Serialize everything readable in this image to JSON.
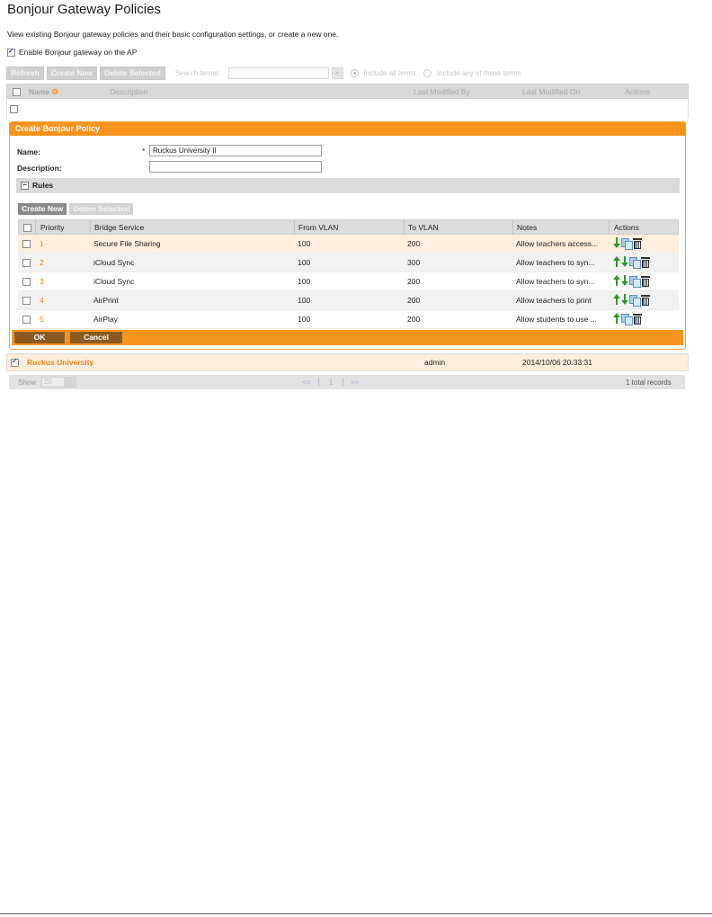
{
  "page": {
    "title": "Bonjour Gateway Policies",
    "intro": "View existing Bonjour gateway policies and their basic configuration settings, or create a new one.",
    "enable_label": "Enable Bonjour gateway on the AP"
  },
  "toolbar": {
    "refresh": "Refresh",
    "create_new": "Create New",
    "delete_selected": "Delete Selected",
    "search_label": "Search terms:",
    "search_value": "",
    "clear": "×",
    "include_all": "Include all terms",
    "include_any": "Include any of these terms"
  },
  "grid": {
    "columns": {
      "name": "Name",
      "description": "Description",
      "last_modified_by": "Last Modified By",
      "last_modified_on": "Last Modified On",
      "actions": "Actions"
    }
  },
  "create_panel": {
    "title": "Create Bonjour Policy",
    "name_label": "Name:",
    "required_mark": "*",
    "name_value": "Ruckus University II",
    "description_label": "Description:",
    "description_value": "",
    "rules_label": "Rules",
    "rules_toggle": "−",
    "rules_create_new": "Create New",
    "rules_delete_selected": "Delete Selected",
    "rules_columns": {
      "priority": "Priority",
      "bridge_service": "Bridge Service",
      "from_vlan": "From VLAN",
      "to_vlan": "To VLAN",
      "notes": "Notes",
      "actions": "Actions"
    },
    "rules": [
      {
        "priority": "1",
        "service": "Secure File Sharing",
        "from_vlan": "100",
        "to_vlan": "200",
        "notes": "Allow teachers access..."
      },
      {
        "priority": "2",
        "service": "iCloud Sync",
        "from_vlan": "100",
        "to_vlan": "300",
        "notes": "Allow teachers to syn..."
      },
      {
        "priority": "3",
        "service": "iCloud Sync",
        "from_vlan": "100",
        "to_vlan": "200",
        "notes": "Allow teachers to syn..."
      },
      {
        "priority": "4",
        "service": "AirPrint",
        "from_vlan": "100",
        "to_vlan": "200",
        "notes": "Allow teachers to print"
      },
      {
        "priority": "5",
        "service": "AirPlay",
        "from_vlan": "100",
        "to_vlan": "200",
        "notes": "Allow students to use ..."
      }
    ],
    "ok": "OK",
    "cancel": "Cancel"
  },
  "existing": {
    "name": "Ruckus University",
    "last_modified_by": "admin",
    "last_modified_on": "2014/10/06 20:33:31"
  },
  "pager": {
    "show_label": "Show",
    "page_size": "20",
    "prev": "<<",
    "page": "1",
    "next": ">>",
    "total": "1 total records"
  },
  "colors": {
    "accent": "#f7941e",
    "accent_dark": "#8b5a22",
    "link": "#e8861a",
    "header_gray": "#d9d9d9",
    "icon_green": "#2b9a2b"
  }
}
